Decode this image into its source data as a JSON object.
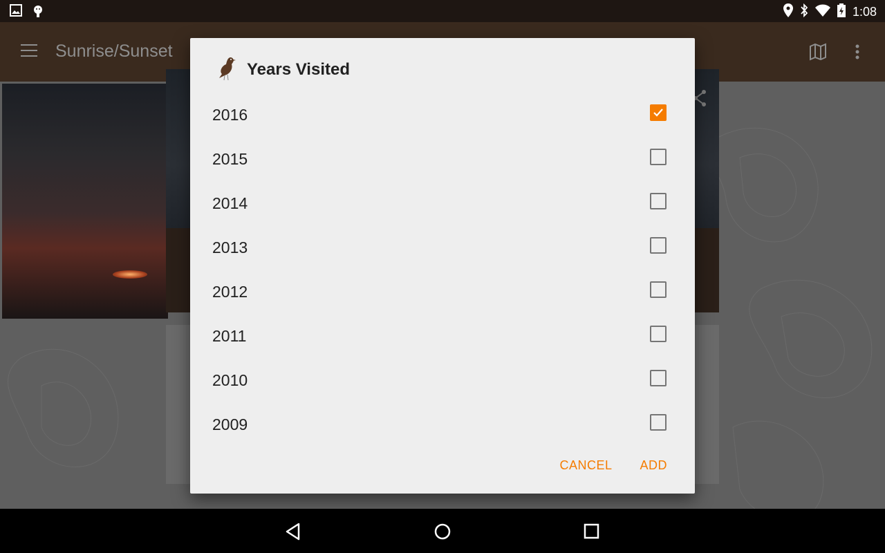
{
  "status_bar": {
    "time": "1:08",
    "left_icons": [
      "image-icon",
      "android-debug-icon"
    ],
    "right_icons": [
      "location-icon",
      "bluetooth-icon",
      "wifi-icon",
      "battery-charging-icon"
    ]
  },
  "app_bar": {
    "title": "Sunrise/Sunset",
    "actions": [
      "map-icon",
      "overflow-menu-icon"
    ]
  },
  "dialog": {
    "title": "Years Visited",
    "header_icon": "bird-logo-icon",
    "items": [
      {
        "label": "2016",
        "checked": true
      },
      {
        "label": "2015",
        "checked": false
      },
      {
        "label": "2014",
        "checked": false
      },
      {
        "label": "2013",
        "checked": false
      },
      {
        "label": "2012",
        "checked": false
      },
      {
        "label": "2011",
        "checked": false
      },
      {
        "label": "2010",
        "checked": false
      },
      {
        "label": "2009",
        "checked": false
      }
    ],
    "cancel_label": "CANCEL",
    "add_label": "ADD"
  },
  "colors": {
    "accent": "#f57c00",
    "app_bar": "#3a2a1e",
    "status_bar": "#1e1612",
    "dialog_bg": "#eeeeee"
  },
  "nav_bar": [
    "back-icon",
    "home-icon",
    "recents-icon"
  ]
}
